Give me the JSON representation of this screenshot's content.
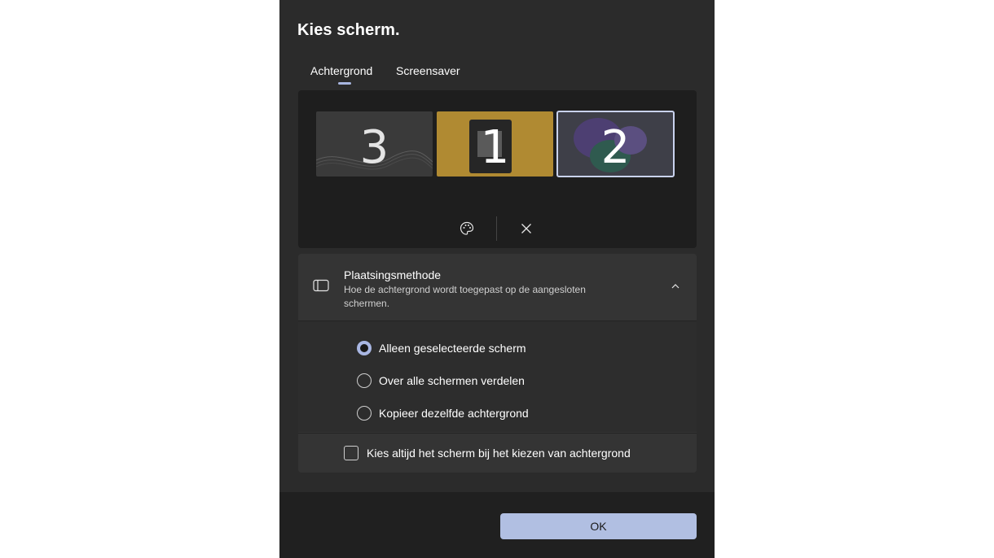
{
  "dialog": {
    "title": "Kies scherm.",
    "tabs": [
      {
        "label": "Achtergrond",
        "selected": true
      },
      {
        "label": "Screensaver",
        "selected": false
      }
    ],
    "monitors": [
      {
        "number": "3",
        "selected": false
      },
      {
        "number": "1",
        "selected": false
      },
      {
        "number": "2",
        "selected": true
      }
    ],
    "actions": {
      "palette_icon": "palette-icon",
      "close_icon": "close-icon"
    },
    "placement": {
      "icon": "panel-icon",
      "title": "Plaatsingsmethode",
      "description": "Hoe de achtergrond wordt toegepast op de aangesloten schermen.",
      "expanded": true,
      "options": [
        {
          "label": "Alleen geselecteerde scherm",
          "selected": true
        },
        {
          "label": "Over alle schermen verdelen",
          "selected": false
        },
        {
          "label": "Kopieer dezelfde achtergrond",
          "selected": false
        }
      ],
      "checkbox_label": "Kies altijd het scherm bij het kiezen van achtergrond",
      "checkbox_checked": false
    },
    "ok_label": "OK",
    "colors": {
      "accent": "#a9b7e3",
      "background": "#2b2b2b",
      "footer": "#202020"
    }
  }
}
